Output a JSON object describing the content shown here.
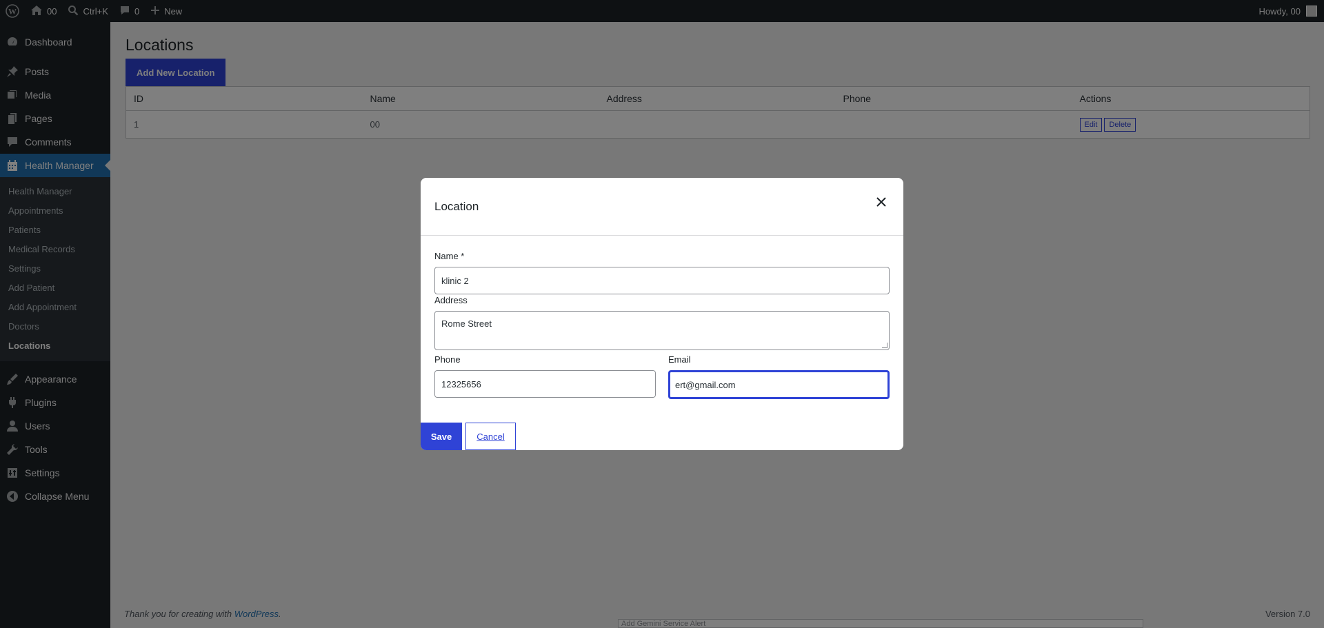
{
  "adminbar": {
    "site_name": "00",
    "search_shortcut": "Ctrl+K",
    "comments_count": "0",
    "new_label": "New",
    "howdy": "Howdy, 00"
  },
  "sidebar": {
    "items_top": [
      {
        "label": "Dashboard",
        "icon": "dashboard-icon"
      },
      {
        "label": "Posts",
        "icon": "pin-icon"
      },
      {
        "label": "Media",
        "icon": "media-icon"
      },
      {
        "label": "Pages",
        "icon": "pages-icon"
      },
      {
        "label": "Comments",
        "icon": "comment-icon"
      },
      {
        "label": "Health Manager",
        "icon": "calendar-icon"
      }
    ],
    "submenu": [
      "Health Manager",
      "Appointments",
      "Patients",
      "Medical Records",
      "Settings",
      "Add Patient",
      "Add Appointment",
      "Doctors",
      "Locations"
    ],
    "items_bottom": [
      {
        "label": "Appearance",
        "icon": "brush-icon"
      },
      {
        "label": "Plugins",
        "icon": "plugin-icon"
      },
      {
        "label": "Users",
        "icon": "user-icon"
      },
      {
        "label": "Tools",
        "icon": "wrench-icon"
      },
      {
        "label": "Settings",
        "icon": "settings-icon"
      },
      {
        "label": "Collapse Menu",
        "icon": "collapse-icon"
      }
    ]
  },
  "main": {
    "title": "Locations",
    "add_button": "Add New Location",
    "table": {
      "headers": [
        "ID",
        "Name",
        "Address",
        "Phone",
        "Actions"
      ],
      "rows": [
        {
          "id": "1",
          "name": "00",
          "address": "",
          "phone": "",
          "edit": "Edit",
          "delete": "Delete"
        }
      ]
    }
  },
  "footer": {
    "thanks_prefix": "Thank you for creating with ",
    "thanks_link": "WordPress",
    "thanks_suffix": ".",
    "version": "Version 7.0",
    "bottom_strip": "Add Gemini Service Alert"
  },
  "modal": {
    "title": "Location",
    "name_label": "Name *",
    "name_value": "klinic 2",
    "address_label": "Address",
    "address_value": "Rome Street",
    "phone_label": "Phone",
    "phone_value": "12325656",
    "email_label": "Email",
    "email_value": "ert@gmail.com",
    "save": "Save",
    "cancel": "Cancel"
  },
  "colors": {
    "accent": "#2f43d6",
    "adminbar_bg": "#1d2327",
    "menu_current": "#2271b1"
  }
}
